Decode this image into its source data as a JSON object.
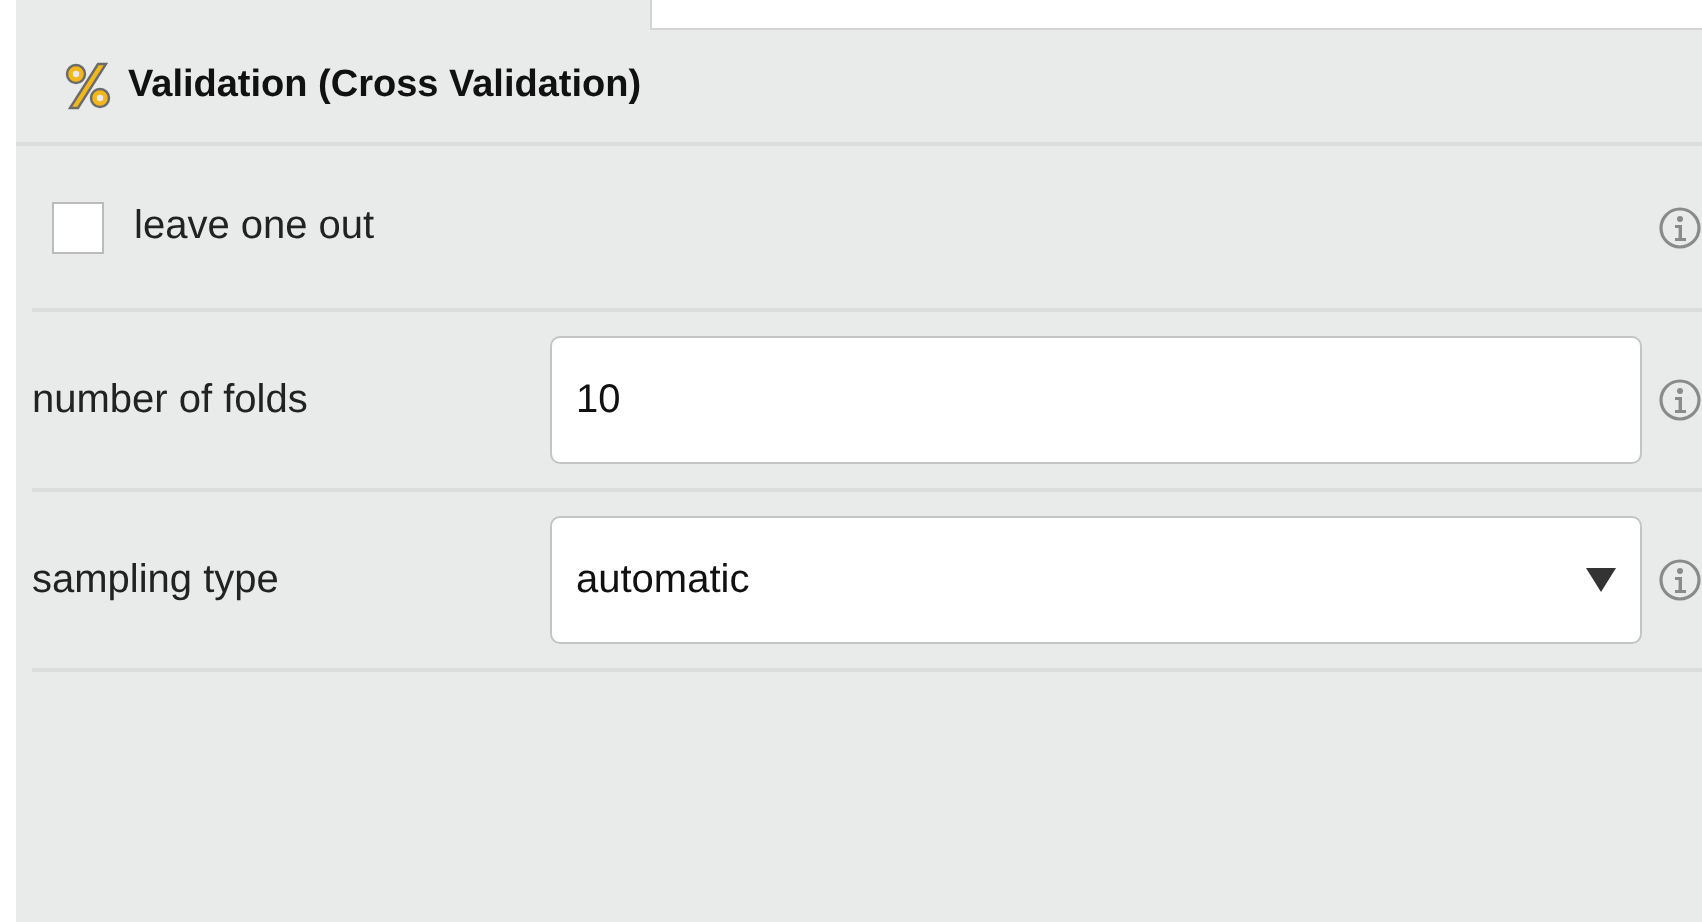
{
  "panel": {
    "title": "Validation (Cross Validation)"
  },
  "parameters": [
    {
      "kind": "checkbox",
      "label": "leave one out",
      "checked": false
    },
    {
      "kind": "text",
      "label": "number of folds",
      "value": "10"
    },
    {
      "kind": "select",
      "label": "sampling type",
      "value": "automatic"
    }
  ]
}
